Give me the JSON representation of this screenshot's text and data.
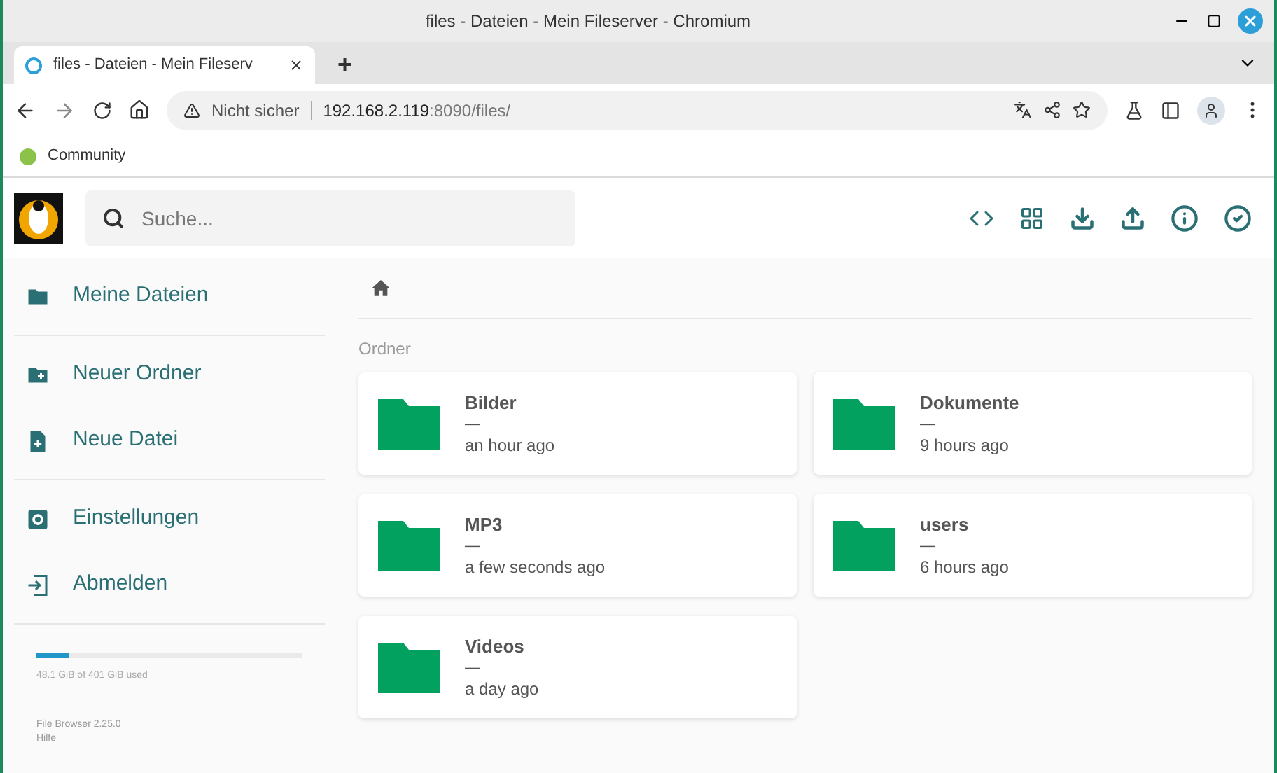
{
  "window": {
    "title": "files - Dateien - Mein Fileserver - Chromium"
  },
  "tabs": [
    {
      "label": "files - Dateien - Mein Fileserv",
      "selected": true
    }
  ],
  "new_tab": "+",
  "address_bar": {
    "security": "Nicht sicher",
    "url_host": "192.168.2.119",
    "url_rest": ":8090/files/"
  },
  "bookmarks": [
    {
      "label": "Community"
    }
  ],
  "search": {
    "placeholder": "Suche..."
  },
  "sidebar": {
    "groups": [
      [
        {
          "kind": "folder",
          "label": "Meine Dateien"
        }
      ],
      [
        {
          "kind": "new-folder",
          "label": "Neuer Ordner"
        },
        {
          "kind": "new-file",
          "label": "Neue Datei"
        }
      ],
      [
        {
          "kind": "settings",
          "label": "Einstellungen"
        },
        {
          "kind": "logout",
          "label": "Abmelden"
        }
      ]
    ],
    "storage": {
      "level": 0.12,
      "reading": "48.1 GiB of 401 GiB used"
    },
    "version": "File Browser 2.25.0",
    "help": "Hilfe"
  },
  "section_title": "Ordner",
  "folders": [
    {
      "name": "Bilder",
      "size": "—",
      "modified": "an hour ago"
    },
    {
      "name": "Dokumente",
      "size": "—",
      "modified": "9 hours ago"
    },
    {
      "name": "MP3",
      "size": "—",
      "modified": "a few seconds ago"
    },
    {
      "name": "users",
      "size": "—",
      "modified": "6 hours ago"
    },
    {
      "name": "Videos",
      "size": "—",
      "modified": "a day ago"
    }
  ]
}
